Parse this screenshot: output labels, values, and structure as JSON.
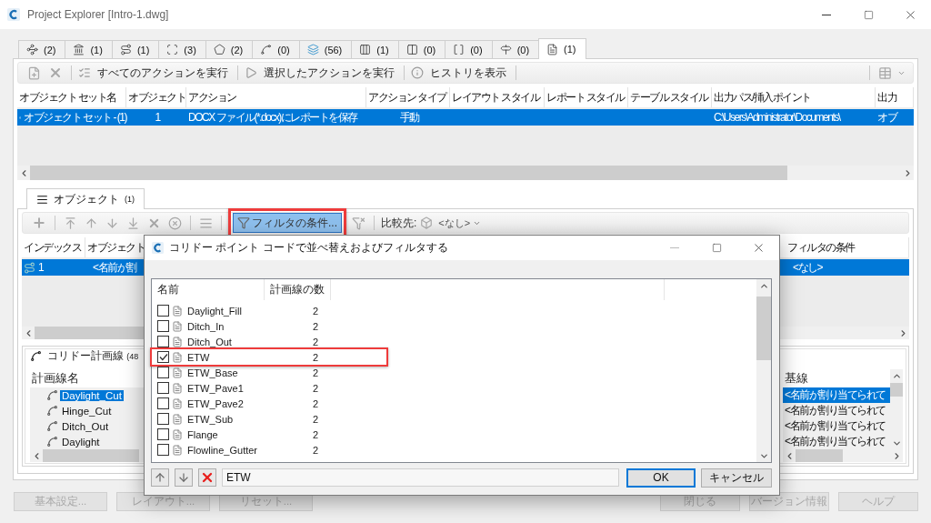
{
  "window": {
    "title": "Project Explorer [Intro-1.dwg]"
  },
  "tabs": [
    {
      "count": "(2)",
      "selected": false
    },
    {
      "count": "(1)",
      "selected": false
    },
    {
      "count": "(1)",
      "selected": false
    },
    {
      "count": "(3)",
      "selected": false
    },
    {
      "count": "(2)",
      "selected": false
    },
    {
      "count": "(0)",
      "selected": false
    },
    {
      "count": "(56)",
      "selected": false
    },
    {
      "count": "(1)",
      "selected": false
    },
    {
      "count": "(0)",
      "selected": false
    },
    {
      "count": "(0)",
      "selected": false
    },
    {
      "count": "(0)",
      "selected": false
    },
    {
      "count": "(1)",
      "selected": true
    }
  ],
  "toolbar": {
    "actions": [
      "すべてのアクションを実行",
      "選択したアクションを実行",
      "ヒストリを表示"
    ]
  },
  "object_sets": {
    "columns": [
      "オブジェクト セット名",
      "オブジェクト",
      "アクション",
      "アクション タイプ",
      "レイアウト スタイル",
      "レポート スタイル",
      "テーブル スタイル",
      "出力パス/挿入ポイント",
      "出力"
    ],
    "rows": [
      {
        "selected": true,
        "cells": [
          "オブジェクト セット - (1)",
          "1",
          "DOCX ファイル(*.docx)にレポートを保存",
          "手動",
          "",
          "",
          "",
          "C:\\Users\\Administrator\\Documents\\",
          "オブ"
        ]
      }
    ]
  },
  "object_tab": {
    "label": "オブジェクト",
    "count": "(1)",
    "selected": true
  },
  "object_toolbar": {
    "filter_button": {
      "label": "フィルタの条件...",
      "pressed": true,
      "highlighted": true
    },
    "compare_label": "比較先:",
    "compare_value": "<なし>"
  },
  "objects": {
    "columns": [
      "インデックス",
      "オブジェクト",
      "フィルタの条件"
    ],
    "rows": [
      {
        "selected": true,
        "cells": [
          "1",
          "<名前が割",
          "<なし>"
        ]
      }
    ]
  },
  "corridor_panel": {
    "title": "コリドー計画線",
    "count": "(48",
    "left": {
      "header": "計画線名",
      "rows": [
        {
          "name": "Daylight_Cut",
          "selected": true
        },
        {
          "name": "Hinge_Cut",
          "selected": false
        },
        {
          "name": "Ditch_Out",
          "selected": false
        },
        {
          "name": "Daylight",
          "selected": false
        }
      ]
    },
    "right": {
      "header": "基線",
      "rows": [
        {
          "name": "<名前が割り当てられて",
          "selected": true
        },
        {
          "name": "<名前が割り当てられて",
          "selected": false
        },
        {
          "name": "<名前が割り当てられて",
          "selected": false
        },
        {
          "name": "<名前が割り当てられて",
          "selected": false
        }
      ]
    }
  },
  "footer_left": [
    {
      "label": "基本設定...",
      "disabled": true
    },
    {
      "label": "レイアウト...",
      "disabled": true
    },
    {
      "label": "リセット...",
      "disabled": true
    }
  ],
  "footer_right": [
    {
      "label": "閉じる",
      "disabled": true
    },
    {
      "label": "バージョン情報",
      "disabled": true
    },
    {
      "label": "ヘルプ",
      "disabled": true
    }
  ],
  "dialog": {
    "title": "コリドー ポイント コードで並べ替えおよびフィルタする",
    "columns": [
      "名前",
      "計画線の数"
    ],
    "rows": [
      {
        "name": "Daylight_Fill",
        "count": "2",
        "checked": false,
        "highlighted": false
      },
      {
        "name": "Ditch_In",
        "count": "2",
        "checked": false,
        "highlighted": false
      },
      {
        "name": "Ditch_Out",
        "count": "2",
        "checked": false,
        "highlighted": false
      },
      {
        "name": "ETW",
        "count": "2",
        "checked": true,
        "highlighted": true
      },
      {
        "name": "ETW_Base",
        "count": "2",
        "checked": false,
        "highlighted": false
      },
      {
        "name": "ETW_Pave1",
        "count": "2",
        "checked": false,
        "highlighted": false
      },
      {
        "name": "ETW_Pave2",
        "count": "2",
        "checked": false,
        "highlighted": false
      },
      {
        "name": "ETW_Sub",
        "count": "2",
        "checked": false,
        "highlighted": false
      },
      {
        "name": "Flange",
        "count": "2",
        "checked": false,
        "highlighted": false
      },
      {
        "name": "Flowline_Gutter",
        "count": "2",
        "checked": false,
        "highlighted": false
      }
    ],
    "filter_text": "ETW",
    "ok": "OK",
    "cancel": "キャンセル"
  }
}
